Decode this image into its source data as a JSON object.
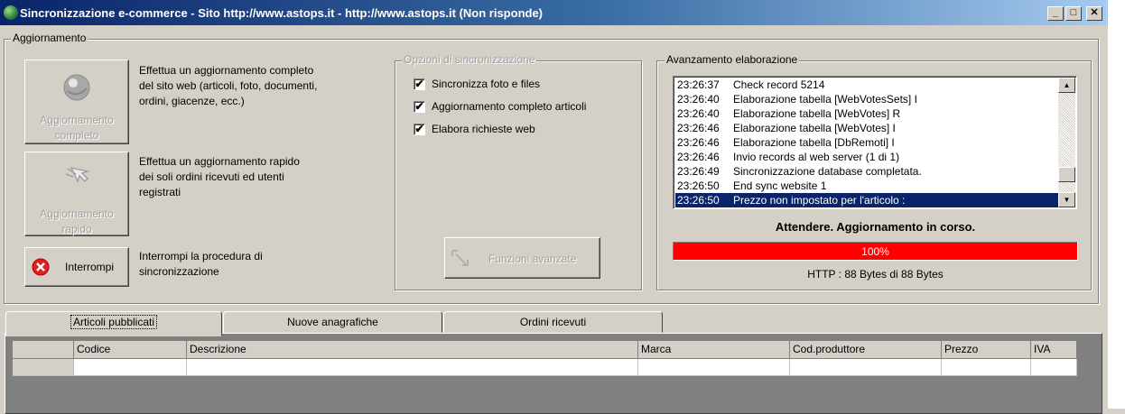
{
  "window": {
    "title": "Sincronizzazione e-commerce - Sito http://www.astops.it - http://www.astops.it (Non risponde)",
    "minimize_glyph": "_",
    "maximize_glyph": "□",
    "close_glyph": "✕"
  },
  "aggiornamento": {
    "legend": "Aggiornamento",
    "full_button": {
      "label_line1": "Aggiornamento",
      "label_line2": "completo",
      "icon": "globe-icon",
      "description": [
        "Effettua un aggiornamento completo",
        "del sito web (articoli, foto, documenti,",
        "ordini, giacenze, ecc.)"
      ]
    },
    "quick_button": {
      "label_line1": "Aggiornamento",
      "label_line2": "rapido",
      "icon": "cursor-icon",
      "description": [
        "Effettua un aggiornamento rapido",
        "dei soli ordini ricevuti ed utenti",
        "registrati"
      ]
    },
    "stop_button": {
      "label": "Interrompi",
      "icon": "stop-icon",
      "description": [
        "Interrompi la procedura di",
        "sincronizzazione"
      ]
    }
  },
  "options": {
    "legend": "Opzioni di sincronizzazione",
    "checkboxes": [
      {
        "label": "Sincronizza foto e files",
        "checked": true
      },
      {
        "label": "Aggiornamento completo articoli",
        "checked": true
      },
      {
        "label": "Elabora richieste web",
        "checked": true
      }
    ],
    "check_glyph": "✔",
    "advanced_button": "Funzioni avanzate"
  },
  "progress_panel": {
    "legend": "Avanzamento elaborazione",
    "log": [
      {
        "time": "23:26:37",
        "message": "Check record 5214"
      },
      {
        "time": "23:26:40",
        "message": "Elaborazione tabella [WebVotesSets] I"
      },
      {
        "time": "23:26:40",
        "message": "Elaborazione tabella [WebVotes] R"
      },
      {
        "time": "23:26:46",
        "message": "Elaborazione tabella [WebVotes] I"
      },
      {
        "time": "23:26:46",
        "message": "Elaborazione tabella [DbRemoti] I"
      },
      {
        "time": "23:26:46",
        "message": "Invio records al web server (1 di 1)"
      },
      {
        "time": "23:26:49",
        "message": "Sincronizzazione database completata."
      },
      {
        "time": "23:26:50",
        "message": "End sync website 1"
      },
      {
        "time": "23:26:50",
        "message": "Prezzo non impostato per l'articolo :",
        "selected": true
      }
    ],
    "status": "Attendere. Aggiornamento in corso.",
    "progress_percent": 100,
    "progress_label": "100%",
    "progress_color": "#ff0000",
    "http_status": "HTTP : 88 Bytes di 88 Bytes",
    "scroll_up": "▲",
    "scroll_down": "▼"
  },
  "tabs": [
    {
      "label": "Articoli pubblicati",
      "active": true
    },
    {
      "label": "Nuove anagrafiche",
      "active": false
    },
    {
      "label": "Ordini ricevuti",
      "active": false
    }
  ],
  "grid": {
    "columns": [
      "",
      "Codice",
      "Descrizione",
      "Marca",
      "Cod.produttore",
      "Prezzo",
      "IVA"
    ]
  }
}
